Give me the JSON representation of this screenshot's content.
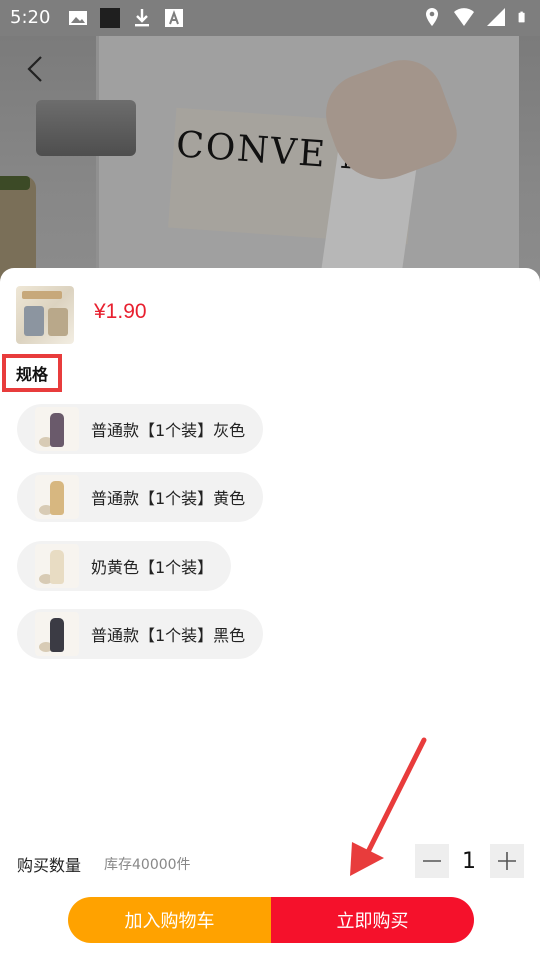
{
  "status_bar": {
    "time": "5:20",
    "left_icons": [
      "image-icon",
      "square-icon",
      "download-icon",
      "font-icon"
    ],
    "right_icons": [
      "location-icon",
      "wifi-icon",
      "signal-icon",
      "battery-icon"
    ]
  },
  "hero": {
    "text": "CONVE NT"
  },
  "product": {
    "price": "¥1.90"
  },
  "spec": {
    "title": "规格",
    "options": [
      {
        "label": "普通款【1个装】灰色",
        "bottle_color": "#6a5a6b"
      },
      {
        "label": "普通款【1个装】黄色",
        "bottle_color": "#d7b780"
      },
      {
        "label": "奶黄色【1个装】",
        "bottle_color": "#e8dcc3"
      },
      {
        "label": "普通款【1个装】黑色",
        "bottle_color": "#3b3b44"
      }
    ]
  },
  "purchase": {
    "qty_label": "购买数量",
    "stock": "库存40000件",
    "quantity": "1"
  },
  "actions": {
    "add_to_cart": "加入购物车",
    "buy_now": "立即购买"
  },
  "colors": {
    "price": "#e8202f",
    "cart_button": "#ffa200",
    "buy_button": "#f5112b",
    "annotation": "#e83c3c"
  }
}
